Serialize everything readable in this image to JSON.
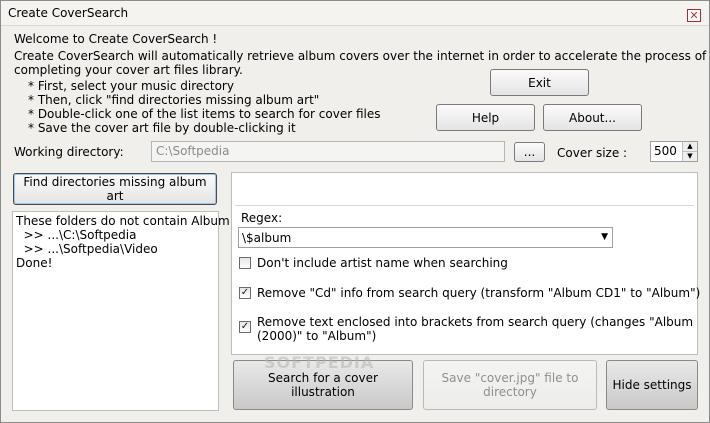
{
  "window": {
    "title": "Create CoverSearch",
    "close_glyph": "✕"
  },
  "intro": {
    "welcome": "Welcome to Create CoverSearch !",
    "description_line1": "Create CoverSearch will automatically retrieve album covers over the internet in order to accelerate the process of",
    "description_line2": "completing your cover art files library.",
    "steps": [
      "* First, select your music directory",
      "* Then, click \"find directories missing album art\"",
      "* Double-click one of the list items to search for cover files",
      "* Save the cover art file by double-clicking it"
    ]
  },
  "buttons": {
    "exit": "Exit",
    "help": "Help",
    "about": "About...",
    "browse": "...",
    "find_line1": "Find directories missing album",
    "find_line2": "art",
    "search_line1": "Search for a cover",
    "search_line2": "illustration",
    "save_line1": "Save \"cover.jpg\" file to",
    "save_line2": "directory",
    "hide_settings": "Hide settings"
  },
  "working_directory": {
    "label": "Working directory:",
    "value": "C:\\Softpedia"
  },
  "cover_size": {
    "label": "Cover size :",
    "value": "500"
  },
  "results": {
    "lines": [
      "These folders do not contain Album",
      "  >> ...\\C:\\Softpedia",
      "  >> ...\\Softpedia\\Video",
      "Done!"
    ]
  },
  "settings": {
    "regex_label": "Regex:",
    "regex_value": "\\$album",
    "options": [
      {
        "label": "Don't include artist name when searching",
        "checked": false
      },
      {
        "label": "Remove \"Cd\" info from search query (transform \"Album CD1\" to \"Album\")",
        "checked": true
      },
      {
        "label_line1": "Remove text enclosed into brackets from search query (changes \"Album",
        "label_line2": "(2000)\" to \"Album\")",
        "checked": true
      }
    ]
  },
  "watermark": "SOFTPEDIA",
  "icons": {
    "close": "close-icon",
    "dropdown": "chevron-down-icon",
    "spin_up": "spin-up-icon",
    "spin_down": "spin-down-icon",
    "check": "checkmark-icon"
  }
}
